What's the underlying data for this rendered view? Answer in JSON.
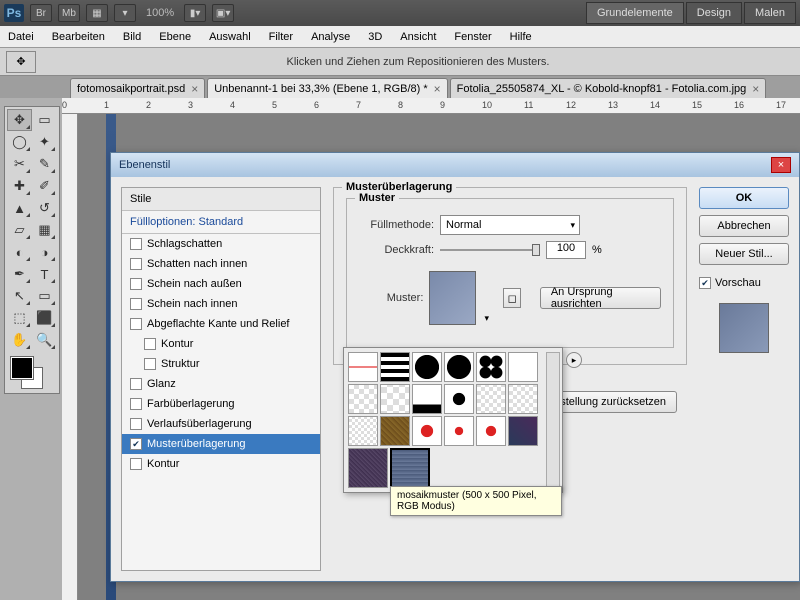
{
  "topbar": {
    "logo": "Ps",
    "btns": [
      "Br",
      "Mb"
    ],
    "zoom": "100%"
  },
  "workspace": {
    "tabs": [
      "Grundelemente",
      "Design",
      "Malen"
    ],
    "active": 0
  },
  "menu": [
    "Datei",
    "Bearbeiten",
    "Bild",
    "Ebene",
    "Auswahl",
    "Filter",
    "Analyse",
    "3D",
    "Ansicht",
    "Fenster",
    "Hilfe"
  ],
  "optbar": {
    "hint": "Klicken und Ziehen zum Repositionieren des Musters."
  },
  "docs": [
    {
      "label": "fotomosaikportrait.psd"
    },
    {
      "label": "Unbenannt-1 bei 33,3% (Ebene 1, RGB/8) *"
    },
    {
      "label": "Fotolia_25505874_XL - © Kobold-knopf81 - Fotolia.com.jpg"
    }
  ],
  "ruler_ticks": [
    "0",
    "1",
    "2",
    "3",
    "4",
    "5",
    "6",
    "7",
    "8",
    "9",
    "10",
    "11",
    "12",
    "13",
    "14",
    "15",
    "16",
    "17"
  ],
  "dialog": {
    "title": "Ebenenstil",
    "styles_title": "Stile",
    "fill_opts": "Füllloptionen: Standard",
    "items": [
      {
        "label": "Schlagschatten",
        "on": false,
        "indent": false
      },
      {
        "label": "Schatten nach innen",
        "on": false,
        "indent": false
      },
      {
        "label": "Schein nach außen",
        "on": false,
        "indent": false
      },
      {
        "label": "Schein nach innen",
        "on": false,
        "indent": false
      },
      {
        "label": "Abgeflachte Kante und Relief",
        "on": false,
        "indent": false
      },
      {
        "label": "Kontur",
        "on": false,
        "indent": true
      },
      {
        "label": "Struktur",
        "on": false,
        "indent": true
      },
      {
        "label": "Glanz",
        "on": false,
        "indent": false
      },
      {
        "label": "Farbüberlagerung",
        "on": false,
        "indent": false
      },
      {
        "label": "Verlaufsüberlagerung",
        "on": false,
        "indent": false
      },
      {
        "label": "Musterüberlagerung",
        "on": true,
        "indent": false,
        "sel": true
      },
      {
        "label": "Kontur",
        "on": false,
        "indent": false
      }
    ],
    "section": "Musterüberlagerung",
    "sub": "Muster",
    "fill_label": "Füllmethode:",
    "fill_value": "Normal",
    "opacity_label": "Deckkraft:",
    "opacity_value": "100",
    "opacity_pct": "%",
    "pattern_label": "Muster:",
    "snap_btn": "An Ursprung ausrichten",
    "default_btn": "einstellung zurücksetzen",
    "tooltip": "mosaikmuster (500 x 500 Pixel, RGB Modus)",
    "ok": "OK",
    "cancel": "Abbrechen",
    "newstyle": "Neuer Stil...",
    "preview": "Vorschau"
  }
}
